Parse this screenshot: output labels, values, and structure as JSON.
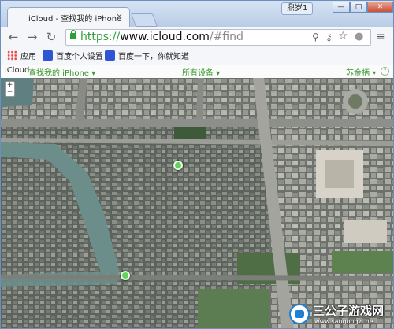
{
  "window": {
    "profile_label": "鼎岁1",
    "minimize": "—",
    "maximize": "□",
    "close": "✕"
  },
  "tab": {
    "title": "iCloud - 查找我的 iPhone",
    "close": "×",
    "favicon": "apple-icon"
  },
  "toolbar": {
    "back": "←",
    "forward": "→",
    "reload": "↻",
    "url_scheme": "https://",
    "url_host": "www.icloud.com",
    "url_path": "/#find",
    "menu": "≡"
  },
  "bookmarks": [
    {
      "label": "应用",
      "icon": "apps-icon"
    },
    {
      "label": "百度个人设置",
      "icon": "paw-icon"
    },
    {
      "label": "百度一下，你就知道",
      "icon": "paw-icon"
    }
  ],
  "icloud": {
    "brand": "iCloud",
    "app_name": "查找我的 iPhone",
    "devices": "所有设备",
    "user": "苏金柄",
    "help": "?"
  },
  "map": {
    "zoom_in": "+",
    "zoom_out": "−"
  },
  "watermark": {
    "title": "三公子游戏网",
    "url": "www.sangongzi.net"
  }
}
